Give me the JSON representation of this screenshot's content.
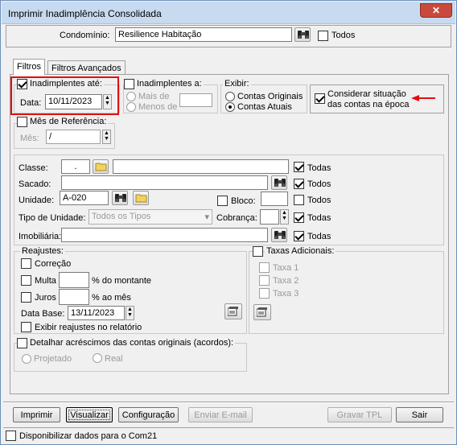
{
  "window": {
    "title": "Imprimir Inadimplência Consolidada",
    "close_label": "✕"
  },
  "header": {
    "condominio_label": "Condomínio:",
    "condominio_value": "Resilience Habitação",
    "todos_label": "Todos"
  },
  "tabs": [
    {
      "label": "Filtros"
    },
    {
      "label": "Filtros Avançados"
    }
  ],
  "inadimplentes_ate": {
    "label": "Inadimplentes até:",
    "data_label": "Data:",
    "data_value": "10/11/2023"
  },
  "inadimplentes_a": {
    "label": "Inadimplentes a:",
    "mais_de": "Mais de",
    "menos_de": "Menos de"
  },
  "exibir": {
    "label": "Exibir:",
    "option1": "Contas Originais",
    "option2": "Contas Atuais"
  },
  "considerar": {
    "line1": "Considerar situação",
    "line2": "das contas na época"
  },
  "mes_referencia": {
    "label": "Mês de Referência:",
    "mes_label": "Mês:",
    "mes_value": " /"
  },
  "filtros": {
    "classe_label": "Classe:",
    "classe_code": ".",
    "classe_todas": "Todas",
    "sacado_label": "Sacado:",
    "sacado_todos": "Todos",
    "unidade_label": "Unidade:",
    "unidade_value": "A-020",
    "bloco_label": "Bloco:",
    "bloco_todos": "Todos",
    "tipo_label": "Tipo de Unidade:",
    "tipo_value": "Todos os Tipos",
    "cobranca_label": "Cobrança:",
    "cobranca_todas": "Todas",
    "imobiliaria_label": "Imobiliária:",
    "imobiliaria_todas": "Todas"
  },
  "reajustes": {
    "label": "Reajustes:",
    "correcao": "Correção",
    "multa": "Multa",
    "multa_suffix": "% do montante",
    "juros": "Juros",
    "juros_suffix": "% ao mês",
    "data_base_label": "Data Base:",
    "data_base_value": "13/11/2023",
    "exibir_label": "Exibir reajustes no relatório"
  },
  "taxas": {
    "label": "Taxas Adicionais:",
    "taxa1": "Taxa 1",
    "taxa2": "Taxa 2",
    "taxa3": "Taxa 3"
  },
  "acrescimos": {
    "label": "Detalhar acréscimos das contas originais (acordos):",
    "projetado": "Projetado",
    "real": "Real"
  },
  "buttons": {
    "imprimir": "Imprimir",
    "visualizar": "Visualizar",
    "configuracao": "Configuração",
    "enviar": "Enviar E-mail",
    "gravar": "Gravar TPL",
    "sair": "Sair"
  },
  "footer": {
    "disponibilizar": "Disponibilizar dados para o Com21"
  },
  "colors": {
    "highlight": "#e01010",
    "arrow": "#e01010"
  }
}
